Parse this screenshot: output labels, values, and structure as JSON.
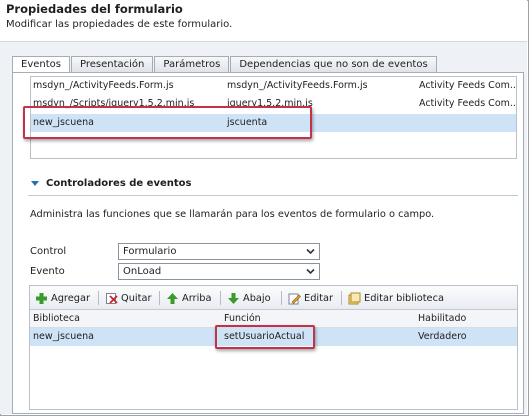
{
  "dialog": {
    "title": "Propiedades del formulario",
    "subtitle": "Modificar las propiedades de este formulario."
  },
  "tabs": [
    {
      "label": "Eventos"
    },
    {
      "label": "Presentación"
    },
    {
      "label": "Parámetros"
    },
    {
      "label": "Dependencias que no son de eventos"
    }
  ],
  "libraries": {
    "rows": [
      {
        "name": "msdyn_/ActivityFeeds.Form.js",
        "display": "msdyn_/ActivityFeeds.Form.js",
        "description": "Activity Feeds Com..."
      },
      {
        "name": "msdyn_/Scripts/jquery1.5.2.min.js",
        "display": "jquery1.5.2.min.js",
        "description": "Activity Feeds Com..."
      },
      {
        "name": "new_jscuena",
        "display": "jscuenta",
        "description": ""
      }
    ]
  },
  "handlers": {
    "section_title": "Controladores de eventos",
    "description": "Administra las funciones que se llamarán para los eventos de formulario o campo.",
    "control_label": "Control",
    "control_value": "Formulario",
    "event_label": "Evento",
    "event_value": "OnLoad",
    "toolbar": {
      "add": "Agregar",
      "remove": "Quitar",
      "up": "Arriba",
      "down": "Abajo",
      "edit": "Editar",
      "edit_library": "Editar biblioteca"
    },
    "columns": [
      "Biblioteca",
      "Función",
      "Habilitado"
    ],
    "rows": [
      {
        "library": "new_jscuena",
        "function": "setUsuarioActual",
        "enabled": "Verdadero"
      }
    ]
  },
  "colors": {
    "selection": "#cfe3f7",
    "highlight_box": "#c0334a",
    "accent": "#2b6db2"
  }
}
